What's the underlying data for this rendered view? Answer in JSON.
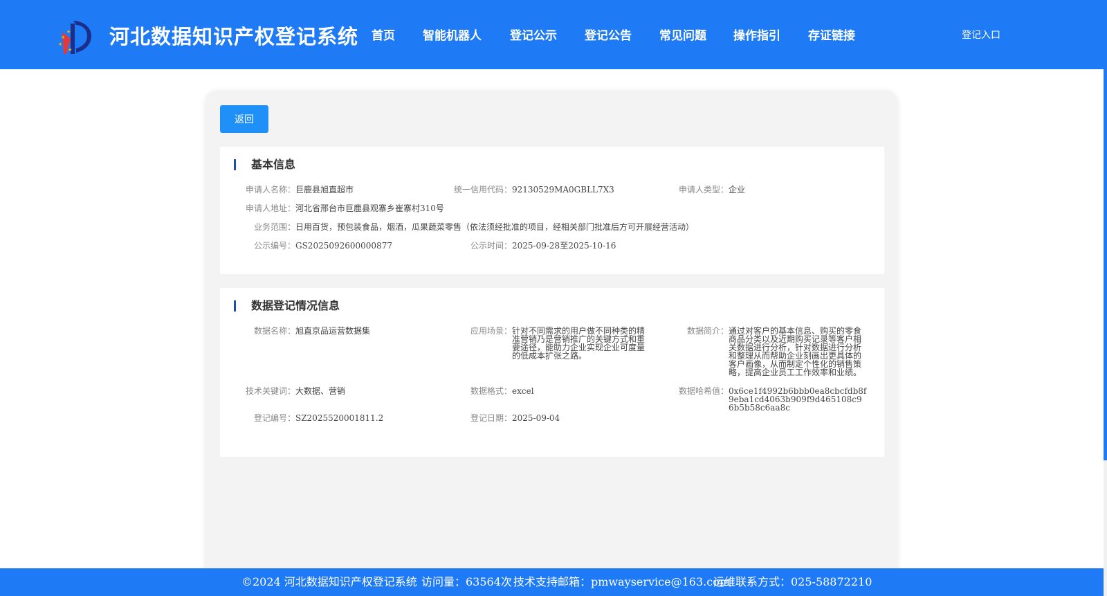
{
  "header": {
    "site_title": "河北数据知识产权登记系统",
    "login_label": "登记入口",
    "nav": [
      {
        "label": "首页",
        "name": "home"
      },
      {
        "label": "智能机器人",
        "name": "robot"
      },
      {
        "label": "登记公示",
        "name": "publicity"
      },
      {
        "label": "登记公告",
        "name": "announcement"
      },
      {
        "label": "常见问题",
        "name": "faq"
      },
      {
        "label": "操作指引",
        "name": "guide"
      },
      {
        "label": "存证链接",
        "name": "evidence"
      }
    ]
  },
  "back_label": "返回",
  "basic": {
    "title": "基本信息",
    "applicant_name_label": "申请人名称：",
    "applicant_name": "巨鹿县旭直超市",
    "credit_code_label": "统一信用代码：",
    "credit_code": "92130529MA0GBLL7X3",
    "applicant_type_label": "申请人类型：",
    "applicant_type": "企业",
    "address_label": "申请人地址：",
    "address": "河北省邢台市巨鹿县观寨乡崔寨村310号",
    "scope_label": "业务范围：",
    "scope": "日用百货，预包装食品，烟酒，瓜果蔬菜零售（依法须经批准的项目，经相关部门批准后方可开展经营活动）",
    "notice_no_label": "公示编号：",
    "notice_no": "GS2025092600000877",
    "notice_time_label": "公示时间：",
    "notice_time": "2025-09-28至2025-10-16"
  },
  "data": {
    "title": "数据登记情况信息",
    "data_name_label": "数据名称：",
    "data_name": "旭直京品运营数据集",
    "scenario_label": "应用场景：",
    "scenario": "针对不同需求的用户做不同种类的精准营销乃是营销推广的关键方式和重要途径，能助力企业实现企业可度量的低成本扩张之路。",
    "intro_label": "数据简介：",
    "intro": "通过对客户的基本信息、购买的零食商品分类以及近期购买记录等客户相关数据进行分析，针对数据进行分析和整理从而帮助企业刻画出更具体的客户画像，从而制定个性化的销售策略，提高企业员工工作效率和业绩。",
    "keywords_label": "技术关键词：",
    "keywords": "大数据、营销",
    "format_label": "数据格式：",
    "format": "excel",
    "hash_label": "数据哈希值：",
    "hash": "0x6ce1f4992b6bbb0ea8cbcfdb8f9eba1cd4063b909f9d465108c96b5b58c6aa8c",
    "reg_no_label": "登记编号：",
    "reg_no": "SZ2025520001811.2",
    "reg_date_label": "登记日期：",
    "reg_date": "2025-09-04"
  },
  "footer": {
    "copyright": "©2024 河北数据知识产权登记系统",
    "visits": "访问量：63564次",
    "email": "技术支持邮箱：pmwayservice@163.com",
    "phone": "运维联系方式：025-58872210"
  }
}
